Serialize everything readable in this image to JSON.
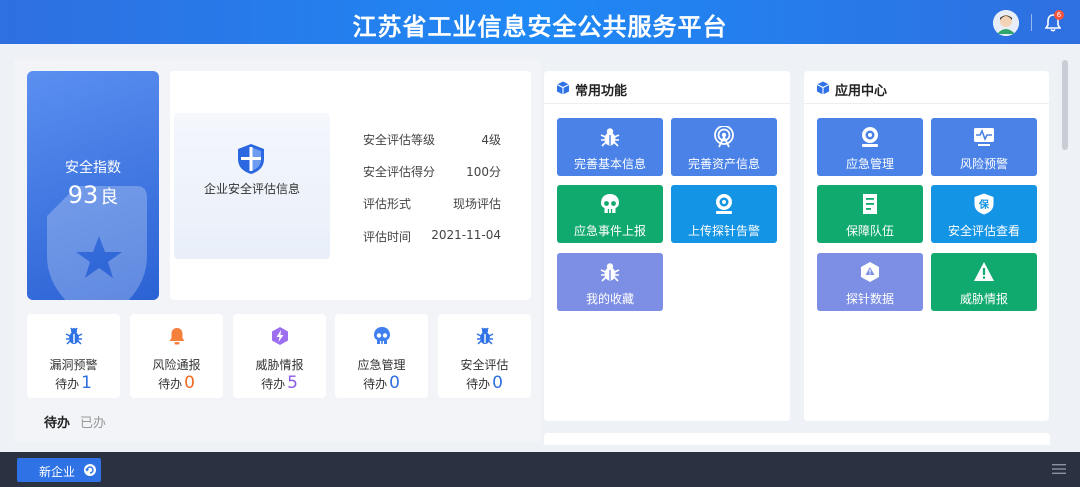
{
  "header": {
    "title": "江苏省工业信息安全公共服务平台",
    "notification_count": "6"
  },
  "score": {
    "label": "安全指数",
    "value": "93",
    "level": "良"
  },
  "info": {
    "badge_text": "企业安全评估信息",
    "rows": [
      {
        "key": "安全评估等级",
        "value": "4级"
      },
      {
        "key": "安全评估得分",
        "value": "100分"
      },
      {
        "key": "评估形式",
        "value": "现场评估"
      },
      {
        "key": "评估时间",
        "value": "2021-11-04"
      }
    ]
  },
  "todos": [
    {
      "name": "漏洞预警",
      "prefix": "待办",
      "count": "1",
      "count_color": "#2f6fe0",
      "icon": "bug-icon",
      "icon_color": "#2f72e6"
    },
    {
      "name": "风险通报",
      "prefix": "待办",
      "count": "0",
      "count_color": "#f06a1f",
      "icon": "bell-icon",
      "icon_color": "#f5803e"
    },
    {
      "name": "威胁情报",
      "prefix": "待办",
      "count": "5",
      "count_color": "#8a5be8",
      "icon": "bolt-icon",
      "icon_color": "#9c6ff0"
    },
    {
      "name": "应急管理",
      "prefix": "待办",
      "count": "0",
      "count_color": "#2f6fe0",
      "icon": "skull-icon",
      "icon_color": "#3f7ff0"
    },
    {
      "name": "安全评估",
      "prefix": "待办",
      "count": "0",
      "count_color": "#2f6fe0",
      "icon": "bug-icon",
      "icon_color": "#2f72e6"
    }
  ],
  "tabs": {
    "active": "待办",
    "inactive": "已办"
  },
  "common": {
    "title": "常用功能",
    "tiles": [
      {
        "label": "完善基本信息",
        "icon": "bug-icon",
        "color": "#4a82e8"
      },
      {
        "label": "完善资产信息",
        "icon": "signal-icon",
        "color": "#4a82e8"
      },
      {
        "label": "应急事件上报",
        "icon": "skull-icon",
        "color": "#10a96e"
      },
      {
        "label": "上传探针告警",
        "icon": "camera-icon",
        "color": "#1494e4"
      },
      {
        "label": "我的收藏",
        "icon": "bug-icon",
        "color": "#7d8fe4"
      }
    ]
  },
  "apps": {
    "title": "应用中心",
    "tiles": [
      {
        "label": "应急管理",
        "icon": "camera-icon",
        "color": "#4a82e8"
      },
      {
        "label": "风险预警",
        "icon": "monitor-pulse-icon",
        "color": "#4a82e8"
      },
      {
        "label": "保障队伍",
        "icon": "document-icon",
        "color": "#10a96e"
      },
      {
        "label": "安全评估查看",
        "icon": "shield-bao-icon",
        "color": "#1494e4"
      },
      {
        "label": "探针数据",
        "icon": "alert-badge-icon",
        "color": "#7d8fe4"
      },
      {
        "label": "威胁情报",
        "icon": "warning-icon",
        "color": "#10a96e"
      }
    ]
  },
  "footer": {
    "new_button": "新企业"
  }
}
